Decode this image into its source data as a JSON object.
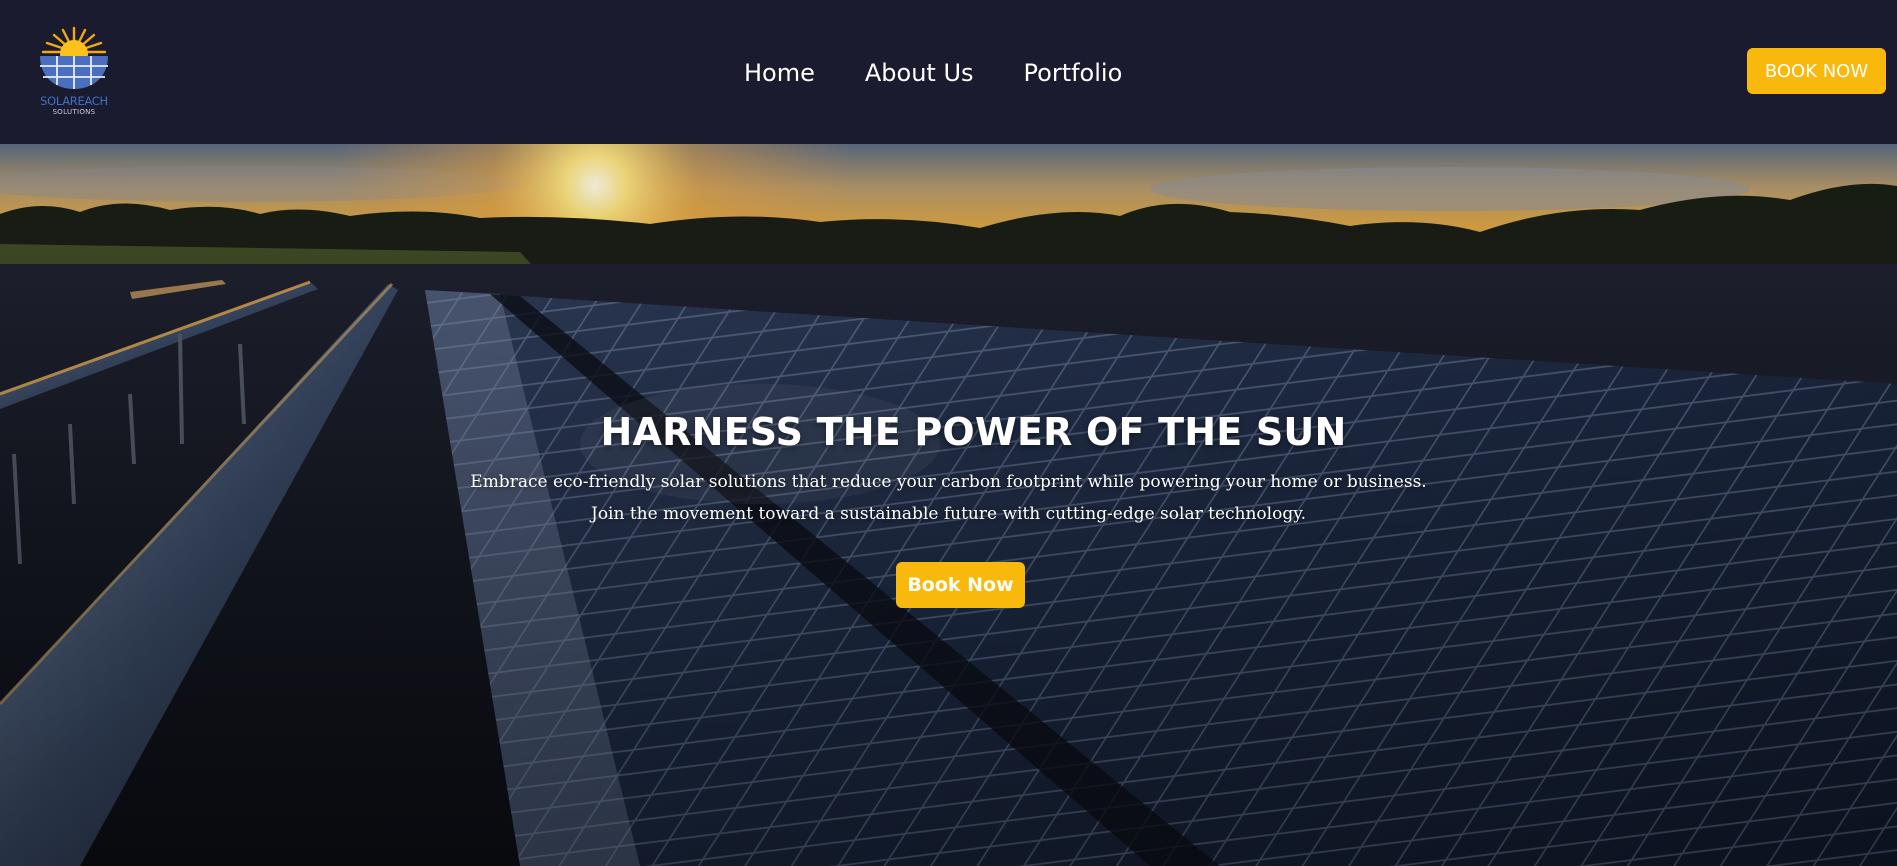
{
  "brand": {
    "name": "SOLAREACH",
    "tagline": "SOLUTIONS",
    "logo_icon": "sun-over-solar-panel-icon"
  },
  "nav": {
    "items": [
      {
        "label": "Home"
      },
      {
        "label": "About Us"
      },
      {
        "label": "Portfolio"
      }
    ]
  },
  "header": {
    "cta_label": "BOOK NOW"
  },
  "hero": {
    "title": "HARNESS THE POWER OF THE SUN",
    "subtitle_line1": "Embrace eco-friendly solar solutions that reduce your carbon footprint while powering your home or business.",
    "subtitle_line2": "Join the movement toward a sustainable future with cutting-edge solar technology.",
    "cta_label": "Book Now",
    "background": "solar-farm-at-sunset"
  },
  "colors": {
    "header_bg": "#1b1b30",
    "accent": "#f9b90c",
    "text": "#ffffff"
  }
}
